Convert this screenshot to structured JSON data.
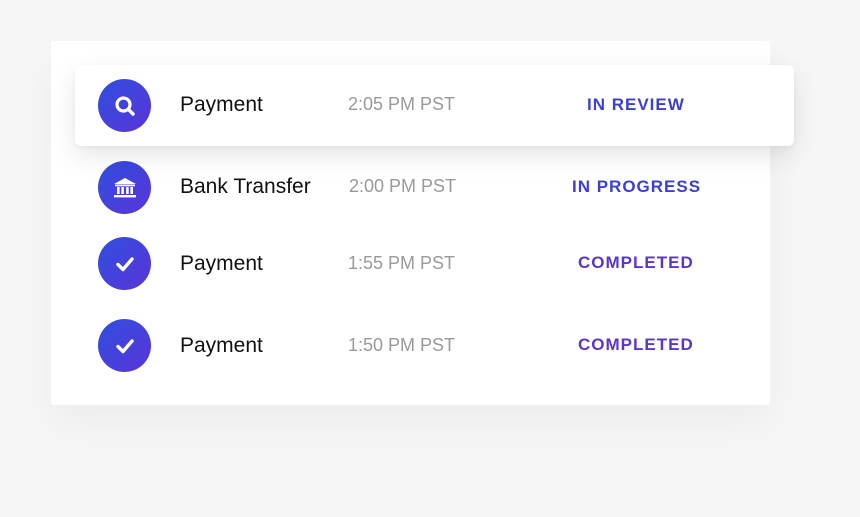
{
  "transactions": [
    {
      "type": "Payment",
      "time": "2:05 PM PST",
      "status": "IN REVIEW",
      "status_color": "#3b3fd8",
      "icon": "search-icon",
      "highlighted": true
    },
    {
      "type": "Bank Transfer",
      "time": "2:00 PM PST",
      "status": "IN PROGRESS",
      "status_color": "#3a3fd9",
      "icon": "bank-icon",
      "highlighted": false
    },
    {
      "type": "Payment",
      "time": "1:55 PM PST",
      "status": "COMPLETED",
      "status_color": "#5a35d6",
      "icon": "checkmark-icon",
      "highlighted": false
    },
    {
      "type": "Payment",
      "time": "1:50 PM PST",
      "status": "COMPLETED",
      "status_color": "#5a35d6",
      "icon": "checkmark-icon",
      "highlighted": false
    }
  ],
  "colors": {
    "icon_gradient_start": "#2f4fe0",
    "icon_gradient_end": "#5a34d8",
    "background": "#f6f6f6",
    "card": "#ffffff"
  }
}
